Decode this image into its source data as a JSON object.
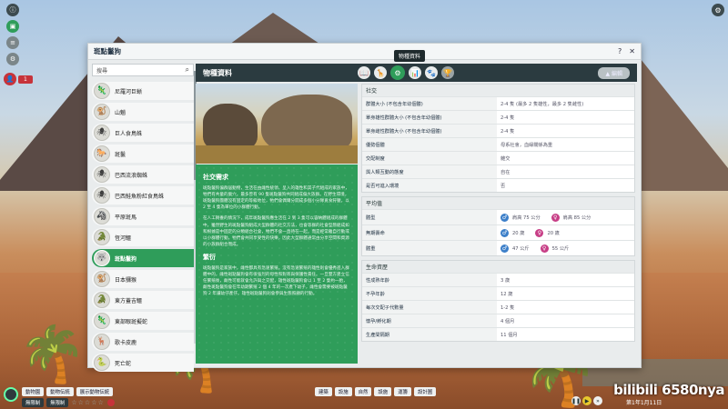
{
  "window": {
    "title": "斑點鬣狗",
    "help": "?",
    "close": "✕"
  },
  "search": {
    "placeholder": "搜尋"
  },
  "species": [
    {
      "name": "尼羅河巨蜥",
      "icon": "🦎"
    },
    {
      "name": "山魈",
      "icon": "🐒"
    },
    {
      "name": "巨人食鳥蛛",
      "icon": "🕷"
    },
    {
      "name": "斑鬣",
      "icon": "🐎"
    },
    {
      "name": "巴西流浪蜘蛛",
      "icon": "🕷"
    },
    {
      "name": "巴西鮭魚粉紅食鳥蛛",
      "icon": "🕷"
    },
    {
      "name": "平原斑馬",
      "icon": "🦓"
    },
    {
      "name": "恆河鱷",
      "icon": "🐊"
    },
    {
      "name": "斑點鬣狗",
      "icon": "🐺"
    },
    {
      "name": "日本獼猴",
      "icon": "🐒"
    },
    {
      "name": "東方蓋吉鱷",
      "icon": "🐊"
    },
    {
      "name": "東部眼斑擬蛇",
      "icon": "🦎"
    },
    {
      "name": "歌卡皮鹿",
      "icon": "🦌"
    },
    {
      "name": "死亡蛇",
      "icon": "🐍"
    }
  ],
  "active_species_index": 8,
  "header": {
    "title": "物種資料",
    "tooltip": "物種資料",
    "tabs": [
      "📖",
      "🦒",
      "⚙",
      "📊",
      "🐾",
      "🏆"
    ],
    "pill": "▲ 編輯"
  },
  "info": {
    "social_title": "社交需求",
    "social_text_1": "斑點鬣狗偏群居動物，生活在由雌性統領、呈入的雄性和其子代組成的家族中，牠們有共童的巢穴。最多曾有 90 隻斑點鬣狗共同組成偏大族群。在野生環境，斑點鬣狗團體沒有固定的等級地位，牠們會偶爾分開成多個小分隊覓食狩獵，以 2 至 4 隻為單位的小群體行動。",
    "social_text_2": "在人工飼養的情況下，成年斑點鬣狗應生活在 2 到 3 隻可以容納體組成的群體中，雖然野生的斑點鬣狗組成大型群體的社交方法，也會等群的社會型態組成如和根據是中固定的分類組合社會，牠們不會一直待在一起，而是經常離自行動或以小群體行動。牠們會共同享受性的快樂，因此大型群體通常由分享空間和資源的小族群組合而成。",
    "breed_title": "繁衍",
    "breed_text": "斑點鬣狗是家族中，雌性都具有急速繁殖。沒有急速繁殖的雄性則會優秀進入群體中的，雌性斑點鬣狗會有很強烈的母性和對寄與保護性責任。一旦雙方建立信任繁殖後，雌性可能就會允許與之交配，雄性斑點鬣狗會以 1 至 2 隻約一胎，雌性斑點鬣狗會在年幼期繁殖 2 個 4 年的一次產下幼子，雌性會需要被斑點鬣狗 2 年讓幼仔產仔。雄性斑點鬣狗則會參與生態照顧的行動。"
  },
  "social": {
    "title": "社交",
    "rows": [
      {
        "label": "群體大小 (不包含年幼個體)",
        "value": "2-4 隻 (最多 2 隻雄性，最多 2 隻雌性)"
      },
      {
        "label": "單身雄性群體大小 (不包含年幼個體)",
        "value": "2-4 隻"
      },
      {
        "label": "單身雌性群體大小 (不包含年幼個體)",
        "value": "2-4 隻"
      },
      {
        "label": "優勢個體",
        "value": "母系社會，血緣關係為重"
      },
      {
        "label": "交配制度",
        "value": "雜交"
      },
      {
        "label": "與人類互動的態度",
        "value": "自在"
      },
      {
        "label": "是否可進入環境",
        "value": "否"
      }
    ]
  },
  "average": {
    "title": "平均值",
    "rows": [
      {
        "label": "體型",
        "male": "肩高 75 公分",
        "female": "肩高 85 公分"
      },
      {
        "label": "無期壽命",
        "male": "20 歲",
        "female": "20 歲"
      },
      {
        "label": "體重",
        "male": "47 公斤",
        "female": "55 公斤"
      }
    ]
  },
  "life": {
    "title": "生命資歷",
    "rows": [
      {
        "label": "性成熟年齡",
        "value": "3 歲"
      },
      {
        "label": "不孕年齡",
        "value": "12 歲"
      },
      {
        "label": "每次交配子代數量",
        "value": "1-2 隻"
      },
      {
        "label": "懷孕/孵化期",
        "value": "4 個月"
      },
      {
        "label": "生產間隔期",
        "value": "11 個月"
      }
    ]
  },
  "bottom": {
    "row1": [
      "動物園",
      "動物伝統",
      "展示動物伝統"
    ],
    "row2_a": "無限制",
    "row2_b": "無限制",
    "stars": "☆☆☆☆☆",
    "mid": [
      "建築",
      "設施",
      "自然",
      "設施",
      "運籌",
      "設計圖"
    ],
    "date": "第1年1月11日",
    "watermark": "bilibili 6580nya"
  },
  "hud": {
    "alert": "1"
  }
}
